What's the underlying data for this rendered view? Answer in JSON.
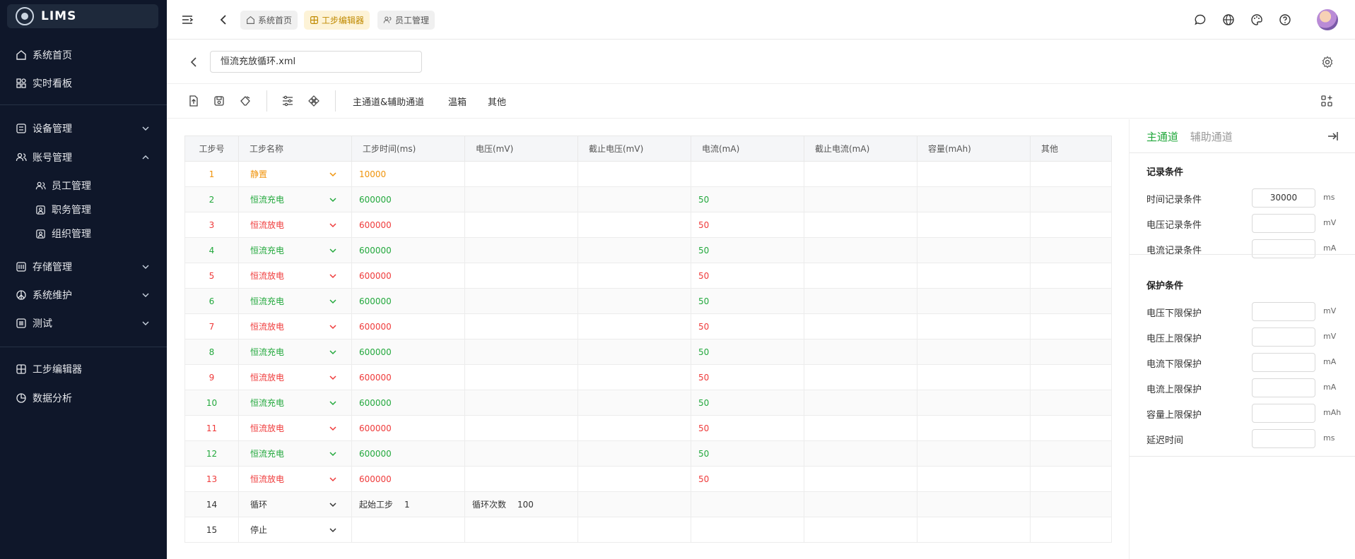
{
  "app": {
    "name": "LIMS"
  },
  "sidebar": {
    "items": [
      {
        "label": "系统首页",
        "icon": "home-icon"
      },
      {
        "label": "实时看板",
        "icon": "dashboard-icon"
      },
      {
        "label": "设备管理",
        "icon": "device-icon"
      },
      {
        "label": "账号管理",
        "icon": "users-icon"
      },
      {
        "label": "员工管理",
        "icon": "users-icon"
      },
      {
        "label": "职务管理",
        "icon": "user-card-icon"
      },
      {
        "label": "组织管理",
        "icon": "user-card-icon"
      },
      {
        "label": "存储管理",
        "icon": "storage-icon"
      },
      {
        "label": "系统维护",
        "icon": "peace-icon"
      },
      {
        "label": "测试",
        "icon": "list-icon"
      },
      {
        "label": "工步编辑器",
        "icon": "grid-icon"
      },
      {
        "label": "数据分析",
        "icon": "pie-icon"
      }
    ]
  },
  "breadcrumbs": [
    {
      "label": "系统首页",
      "active": false
    },
    {
      "label": "工步编辑器",
      "active": true
    },
    {
      "label": "员工管理",
      "active": false
    }
  ],
  "file": {
    "name": "恒流充放循环.xml"
  },
  "toolbar": {
    "tabs": [
      "主通道&辅助通道",
      "温箱",
      "其他"
    ]
  },
  "table": {
    "headers": [
      "工步号",
      "工步名称",
      "工步时间(ms)",
      "电压(mV)",
      "截止电压(mV)",
      "电流(mA)",
      "截止电流(mA)",
      "容量(mAh)",
      "其他"
    ],
    "rows": [
      {
        "no": "1",
        "name": "静置",
        "time": "10000",
        "current": "",
        "color": "orange"
      },
      {
        "no": "2",
        "name": "恒流充电",
        "time": "600000",
        "current": "50",
        "color": "green"
      },
      {
        "no": "3",
        "name": "恒流放电",
        "time": "600000",
        "current": "50",
        "color": "red"
      },
      {
        "no": "4",
        "name": "恒流充电",
        "time": "600000",
        "current": "50",
        "color": "green"
      },
      {
        "no": "5",
        "name": "恒流放电",
        "time": "600000",
        "current": "50",
        "color": "red"
      },
      {
        "no": "6",
        "name": "恒流充电",
        "time": "600000",
        "current": "50",
        "color": "green"
      },
      {
        "no": "7",
        "name": "恒流放电",
        "time": "600000",
        "current": "50",
        "color": "red"
      },
      {
        "no": "8",
        "name": "恒流充电",
        "time": "600000",
        "current": "50",
        "color": "green"
      },
      {
        "no": "9",
        "name": "恒流放电",
        "time": "600000",
        "current": "50",
        "color": "red"
      },
      {
        "no": "10",
        "name": "恒流充电",
        "time": "600000",
        "current": "50",
        "color": "green"
      },
      {
        "no": "11",
        "name": "恒流放电",
        "time": "600000",
        "current": "50",
        "color": "red"
      },
      {
        "no": "12",
        "name": "恒流充电",
        "time": "600000",
        "current": "50",
        "color": "green"
      },
      {
        "no": "13",
        "name": "恒流放电",
        "time": "600000",
        "current": "50",
        "color": "red"
      }
    ],
    "loop_row": {
      "no": "14",
      "name": "循环",
      "start_label": "起始工步",
      "start_value": "1",
      "count_label": "循环次数",
      "count_value": "100"
    },
    "stop_row": {
      "no": "15",
      "name": "停止"
    }
  },
  "panel": {
    "tabs": [
      "主通道",
      "辅助通道"
    ],
    "record": {
      "title": "记录条件",
      "rows": [
        {
          "label": "时间记录条件",
          "value": "30000",
          "unit": "ms"
        },
        {
          "label": "电压记录条件",
          "value": "",
          "unit": "mV"
        },
        {
          "label": "电流记录条件",
          "value": "",
          "unit": "mA"
        }
      ]
    },
    "protect": {
      "title": "保护条件",
      "rows": [
        {
          "label": "电压下限保护",
          "value": "",
          "unit": "mV"
        },
        {
          "label": "电压上限保护",
          "value": "",
          "unit": "mV"
        },
        {
          "label": "电流下限保护",
          "value": "",
          "unit": "mA"
        },
        {
          "label": "电流上限保护",
          "value": "",
          "unit": "mA"
        },
        {
          "label": "容量上限保护",
          "value": "",
          "unit": "mAh"
        },
        {
          "label": "延迟时间",
          "value": "",
          "unit": "ms"
        }
      ]
    }
  },
  "colors": {
    "sidebar_bg": "#0f172a",
    "green": "#22a83c",
    "red": "#ef3a3a",
    "orange": "#f0930a",
    "accent_tab": "#c08a00"
  }
}
